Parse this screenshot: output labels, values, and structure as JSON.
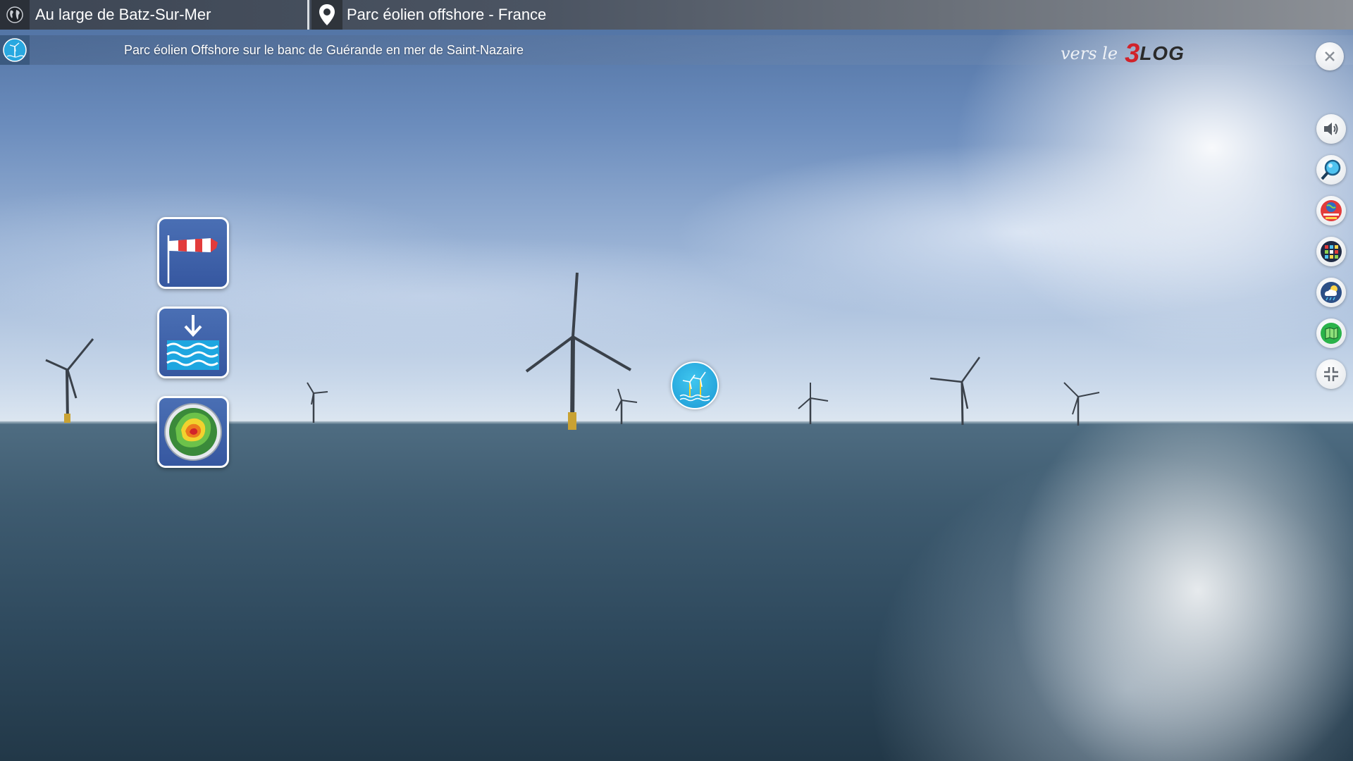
{
  "header": {
    "location": "Au large de Batz-Sur-Mer",
    "title": "Parc éolien offshore - France",
    "location_icon": "globe-icon",
    "title_icon": "map-pin-icon"
  },
  "subtitle": {
    "text": "Parc éolien Offshore sur le banc de Guérande en mer de Saint-Nazaire",
    "icon": "wind-turbine-icon"
  },
  "blog_link": {
    "prefix": "vers le",
    "brand_number": "3",
    "brand_word": "LOG"
  },
  "left_tiles": [
    {
      "name": "windsock-button",
      "icon": "windsock-icon"
    },
    {
      "name": "sea-level-button",
      "icon": "tide-icon"
    },
    {
      "name": "weather-radar-button",
      "icon": "radar-icon"
    }
  ],
  "center_hotspot": {
    "icon": "wind-turbine-icon"
  },
  "right_toolbar": [
    {
      "name": "sound-button",
      "icon": "speaker-icon"
    },
    {
      "name": "zoom-button",
      "icon": "magnifier-icon"
    },
    {
      "name": "panorama-menu-button",
      "icon": "globe-menu-icon"
    },
    {
      "name": "gallery-button",
      "icon": "thumbnails-icon"
    },
    {
      "name": "weather-button",
      "icon": "weather-icon"
    },
    {
      "name": "map-button",
      "icon": "map-icon"
    },
    {
      "name": "exit-fullscreen-button",
      "icon": "compress-icon"
    }
  ],
  "colors": {
    "tile_blue": "#3657a0",
    "hotspot_blue": "#1c98d4",
    "brand_red": "#d1222a"
  }
}
